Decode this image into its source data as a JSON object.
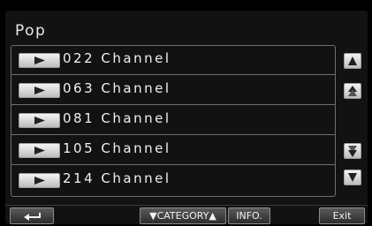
{
  "header": {
    "title": "Pop"
  },
  "channels": [
    {
      "label": "022 Channel"
    },
    {
      "label": "063 Channel"
    },
    {
      "label": "081 Channel"
    },
    {
      "label": "105 Channel"
    },
    {
      "label": "214 Channel"
    }
  ],
  "side_controls": [
    {
      "icon": "up-arrow-icon"
    },
    {
      "icon": "page-up-icon"
    },
    {
      "icon": "page-down-icon"
    },
    {
      "icon": "down-arrow-icon"
    }
  ],
  "bottom_bar": {
    "back_icon": "return-arrow-icon",
    "category_label": "▼CATEGORY▲",
    "info_label": "INFO.",
    "exit_label": "Exit"
  },
  "colors": {
    "background": "#000000",
    "panel": "#121212",
    "text": "#f0f0f0",
    "button_light": "#dcdcdc",
    "button_dark": "#3a3a3a"
  }
}
